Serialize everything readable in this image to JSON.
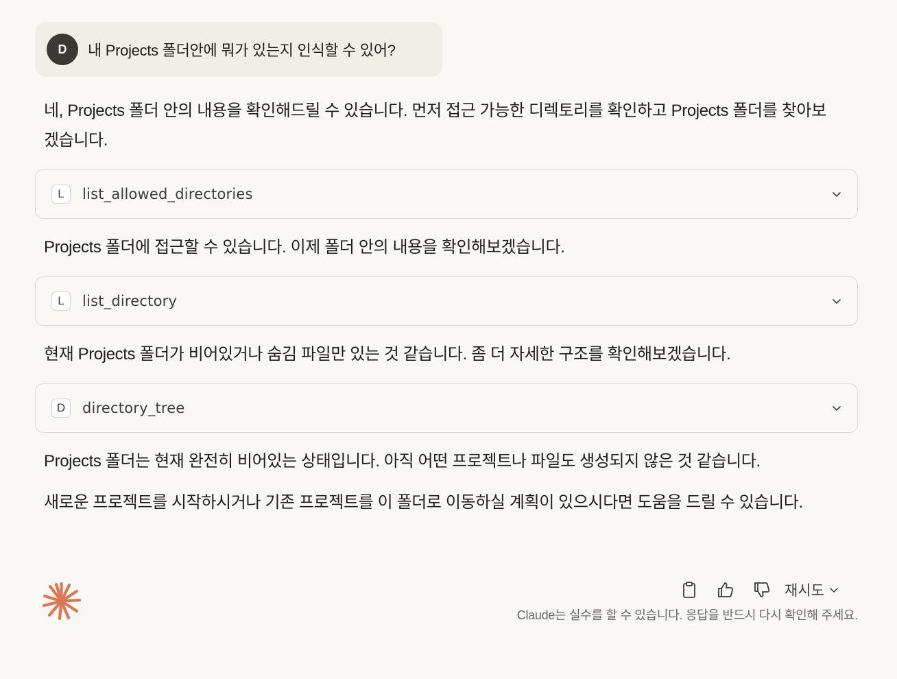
{
  "user_message": {
    "avatar_initial": "D",
    "text": "내 Projects 폴더안에 뭐가 있는지 인식할 수 있어?"
  },
  "assistant": {
    "paragraphs": [
      "네, Projects 폴더 안의 내용을 확인해드릴 수 있습니다. 먼저 접근 가능한 디렉토리를 확인하고 Projects 폴더를 찾아보겠습니다.",
      "Projects 폴더에 접근할 수 있습니다. 이제 폴더 안의 내용을 확인해보겠습니다.",
      "현재 Projects 폴더가 비어있거나 숨김 파일만 있는 것 같습니다. 좀 더 자세한 구조를 확인해보겠습니다.",
      "Projects 폴더는 현재 완전히 비어있는 상태입니다. 아직 어떤 프로젝트나 파일도 생성되지 않은 것 같습니다.",
      "새로운 프로젝트를 시작하시거나 기존 프로젝트를 이 폴더로 이동하실 계획이 있으시다면 도움을 드릴 수 있습니다."
    ],
    "tools": [
      {
        "badge": "L",
        "name": "list_allowed_directories"
      },
      {
        "badge": "L",
        "name": "list_directory"
      },
      {
        "badge": "D",
        "name": "directory_tree"
      }
    ]
  },
  "actions": {
    "copy_icon": "clipboard-icon",
    "like_icon": "thumbs-up-icon",
    "dislike_icon": "thumbs-down-icon",
    "retry_label": "재시도"
  },
  "disclaimer": "Claude는 실수를 할 수 있습니다. 응답을 반드시 다시 확인해 주세요.",
  "colors": {
    "background": "#f9f8f4",
    "user_bubble": "#f0eee6",
    "avatar": "#3a3935",
    "logo": "#d97757",
    "text": "#1f1e1d",
    "muted": "#6b6a66"
  }
}
